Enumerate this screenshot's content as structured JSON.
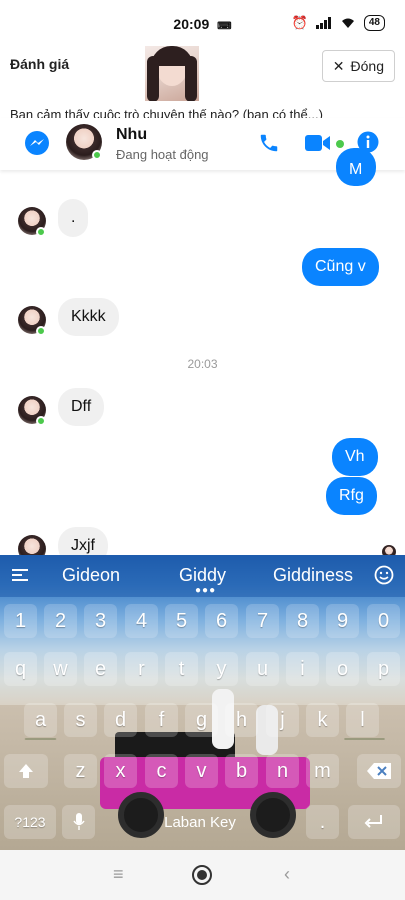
{
  "status_bar": {
    "time": "20:09",
    "battery": "48"
  },
  "review": {
    "title": "Đánh giá",
    "close_label": "Đóng",
    "question": "Bạn cảm thấy cuộc trò chuyện thế nào? (bạn có thể...)"
  },
  "chat": {
    "name": "Nhu",
    "status": "Đang hoạt động"
  },
  "messages": {
    "m0": "M",
    "m1": ".",
    "m2": "Cũng v",
    "m3": "Kkkk",
    "time": "20:03",
    "m4": "Dff",
    "m5": "Vh",
    "m6": "Rfg",
    "m7": "Jxjf"
  },
  "keyboard": {
    "suggestions": [
      "Gideon",
      "Giddy",
      "Giddiness"
    ],
    "numbers": [
      "1",
      "2",
      "3",
      "4",
      "5",
      "6",
      "7",
      "8",
      "9",
      "0"
    ],
    "row1": [
      "q",
      "w",
      "e",
      "r",
      "t",
      "y",
      "u",
      "i",
      "o",
      "p"
    ],
    "row2": [
      "a",
      "s",
      "d",
      "f",
      "g",
      "h",
      "j",
      "k",
      "l"
    ],
    "row3": [
      "z",
      "x",
      "c",
      "v",
      "b",
      "n",
      "m"
    ],
    "sym_label": "?123",
    "space_label": "Laban Key"
  },
  "colors": {
    "messenger_blue": "#0a84ff",
    "online_green": "#4cc94c"
  }
}
